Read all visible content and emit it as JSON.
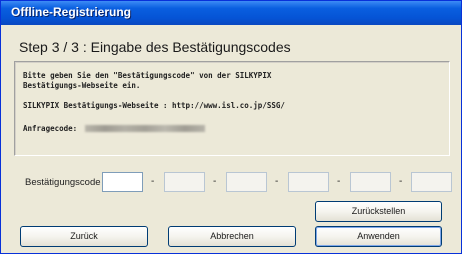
{
  "window": {
    "title": "Offline-Registrierung"
  },
  "step": {
    "title": "Step 3 / 3 : Eingabe des Bestätigungscodes"
  },
  "info": {
    "line1": "Bitte geben Sie den \"Bestätigungscode\" von der SILKYPIX",
    "line2": "Bestätigungs-Webseite ein.",
    "line3": "SILKYPIX Bestätigungs-Webseite : http://www.isl.co.jp/SSG/",
    "request_label": "Anfragecode:"
  },
  "code": {
    "label": "Bestätigungscode",
    "separator": "-"
  },
  "buttons": {
    "reset": "Zurückstellen",
    "back": "Zurück",
    "cancel": "Abbrechen",
    "apply": "Anwenden"
  }
}
